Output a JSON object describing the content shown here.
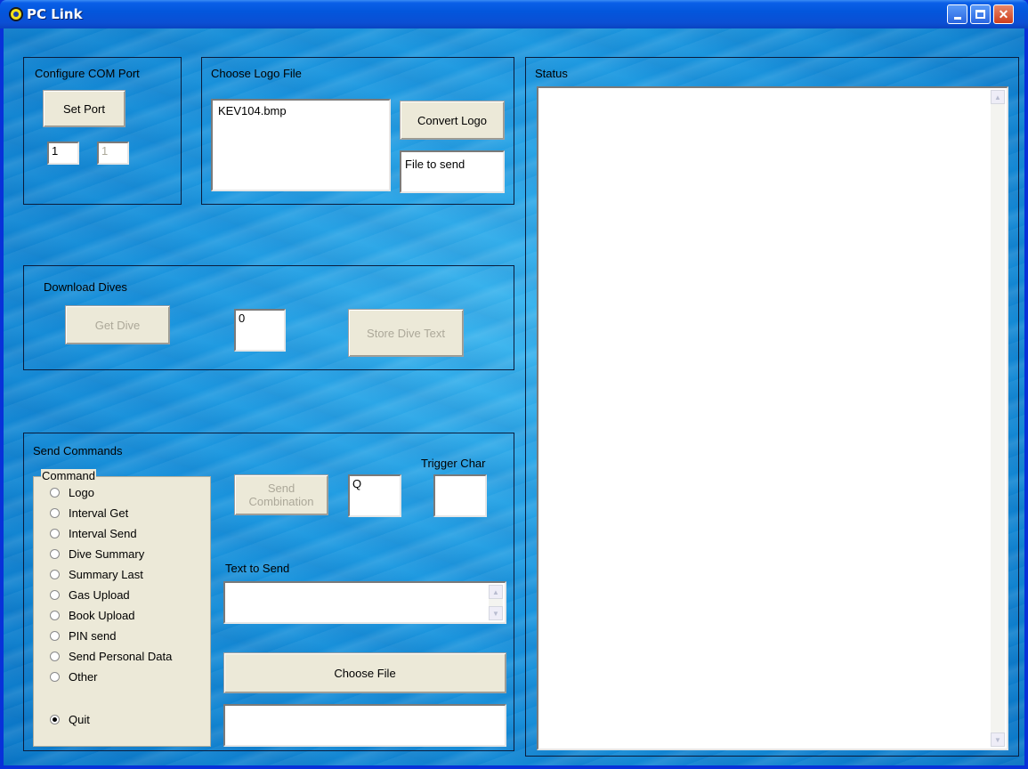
{
  "window": {
    "title": "PC Link"
  },
  "com_port": {
    "title": "Configure COM Port",
    "set_port_label": "Set Port",
    "port_value": "1",
    "port_value_2": "1"
  },
  "logo": {
    "title": "Choose Logo File",
    "file_list": [
      "KEV104.bmp"
    ],
    "convert_label": "Convert Logo",
    "file_to_send": "File to send"
  },
  "download": {
    "title": "Download Dives",
    "get_dive_label": "Get Dive",
    "dive_number": "0",
    "store_label": "Store Dive Text"
  },
  "send": {
    "title": "Send Commands",
    "command_legend": "Command",
    "commands": [
      "Logo",
      "Interval Get",
      "Interval Send",
      "Dive Summary",
      "Summary Last",
      "Gas Upload",
      "Book Upload",
      "PIN send",
      "Send Personal Data",
      "Other"
    ],
    "quit_label": "Quit",
    "selected": "Quit",
    "send_combination_label": "Send\nCombination",
    "send_combination_line1": "Send",
    "send_combination_line2": "Combination",
    "combination_value": "Q",
    "trigger_label": "Trigger Char",
    "trigger_value": "",
    "text_to_send_label": "Text to Send",
    "text_to_send_value": "",
    "choose_file_label": "Choose File",
    "chosen_file_value": ""
  },
  "status": {
    "title": "Status",
    "text": ""
  }
}
